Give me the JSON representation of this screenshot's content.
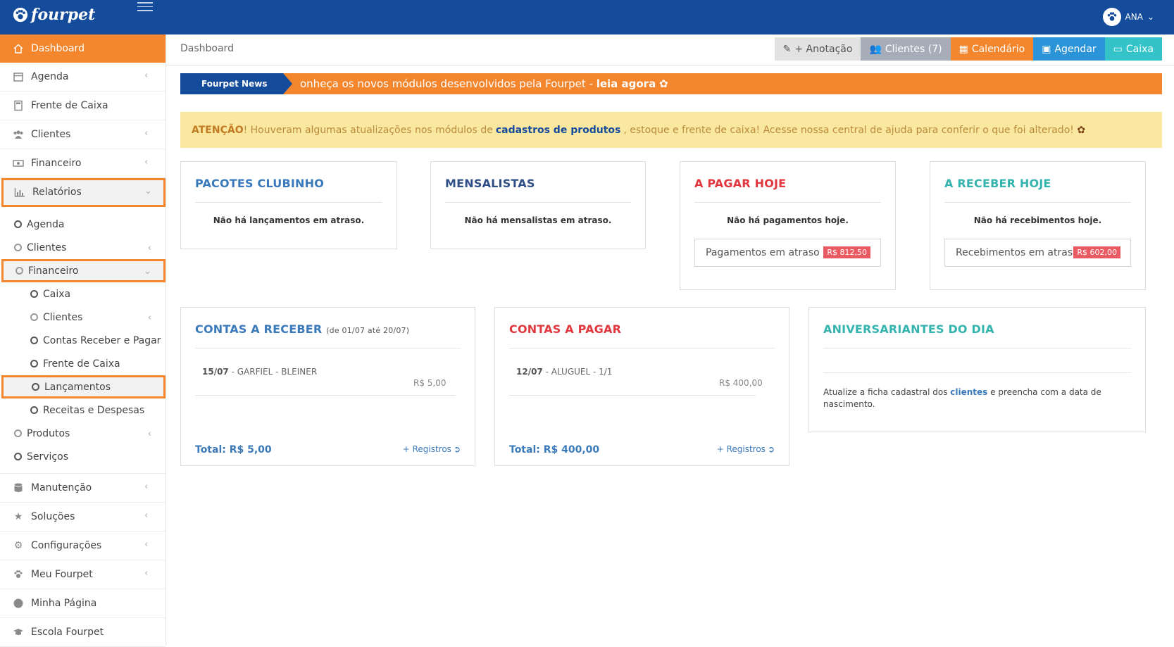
{
  "app": {
    "logo": "fourpet"
  },
  "header": {
    "user": "ANA"
  },
  "sidebar": {
    "items": [
      {
        "label": "Dashboard"
      },
      {
        "label": "Agenda"
      },
      {
        "label": "Frente de Caixa"
      },
      {
        "label": "Clientes"
      },
      {
        "label": "Financeiro"
      },
      {
        "label": "Relatórios"
      }
    ],
    "relatorios_sub": [
      {
        "label": "Agenda"
      },
      {
        "label": "Clientes"
      },
      {
        "label": "Financeiro"
      }
    ],
    "financeiro_sub": [
      {
        "label": "Caixa"
      },
      {
        "label": "Clientes"
      },
      {
        "label": "Contas Receber e Pagar"
      },
      {
        "label": "Frente de Caixa"
      },
      {
        "label": "Lançamentos"
      },
      {
        "label": "Receitas e Despesas"
      }
    ],
    "relatorios_sub2": [
      {
        "label": "Produtos"
      },
      {
        "label": "Serviços"
      }
    ],
    "bottom_items": [
      {
        "label": "Manutenção"
      },
      {
        "label": "Soluções"
      },
      {
        "label": "Configurações"
      },
      {
        "label": "Meu Fourpet"
      },
      {
        "label": "Minha Página"
      },
      {
        "label": "Escola Fourpet"
      }
    ]
  },
  "page": {
    "breadcrumb": "Dashboard"
  },
  "toolbar": {
    "anotacao": "+ Anotação",
    "clientes": "Clientes (7)",
    "calendario": "Calendário",
    "agendar": "Agendar",
    "caixa": "Caixa"
  },
  "news": {
    "label": "Fourpet News",
    "text": "onheça os novos módulos desenvolvidos pela Fourpet - ",
    "link": "leia agora"
  },
  "alert": {
    "strong": "ATENÇÃO",
    "text1": "! Houveram algumas atualizações nos módulos de",
    "link": "cadastros de produtos",
    "text2": ", estoque e frente de caixa! Acesse nossa central de ajuda para conferir o que foi alterado!"
  },
  "cards": {
    "pacotes": {
      "title": "PACOTES CLUBINHO",
      "empty": "Não há lançamentos em atraso."
    },
    "mensalistas": {
      "title": "MENSALISTAS",
      "empty": "Não há mensalistas em atraso."
    },
    "pagar_hoje": {
      "title": "A PAGAR HOJE",
      "empty": "Não há pagamentos hoje.",
      "overdue_label": "Pagamentos em atraso",
      "overdue_value": "R$ 812,50"
    },
    "receber_hoje": {
      "title": "A RECEBER HOJE",
      "empty": "Não há recebimentos hoje.",
      "overdue_label": "Recebimentos em atraso",
      "overdue_value": "R$ 602,00"
    },
    "contas_receber": {
      "title": "CONTAS A RECEBER",
      "subtitle": "(de 01/07 até 20/07)",
      "entry_date": "15/07",
      "entry_desc": " - GARFIEL - BLEINER",
      "entry_value": "R$ 5,00",
      "total": "Total: R$ 5,00",
      "more": "+ Registros"
    },
    "contas_pagar": {
      "title": "CONTAS A PAGAR",
      "entry_date": "12/07",
      "entry_desc": " - ALUGUEL - 1/1",
      "entry_value": "R$ 400,00",
      "total": "Total: R$ 400,00",
      "more": "+ Registros"
    },
    "aniversariantes": {
      "title": "ANIVERSARIANTES DO DIA",
      "text1": "Atualize a ficha cadastral dos ",
      "link": "clientes",
      "text2": " e preencha com a data de nascimento."
    }
  },
  "colors": {
    "primary": "#144b9b",
    "accent": "#f4862e",
    "alert_bg": "#fbe8a0",
    "red": "#e0383e",
    "teal": "#35b4af",
    "blue": "#3a7abb"
  }
}
